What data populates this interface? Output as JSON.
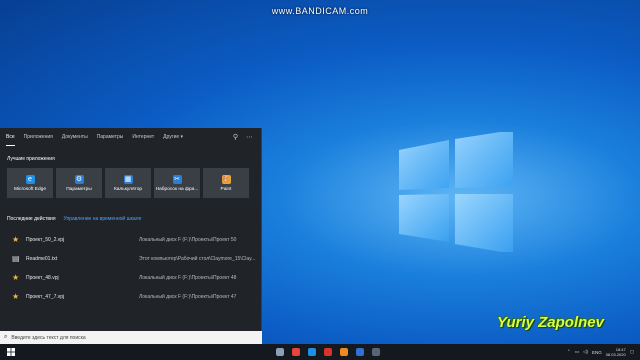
{
  "watermark": "www.BANDICAM.com",
  "signature": "Yuriy Zapolnev",
  "search_panel": {
    "tabs": [
      {
        "label": "Все",
        "active": true
      },
      {
        "label": "Приложения"
      },
      {
        "label": "Документы"
      },
      {
        "label": "Параметры"
      },
      {
        "label": "Интернет"
      },
      {
        "label": "Другие ▾"
      }
    ],
    "tab_icons": [
      "feedback-icon",
      "more-icon"
    ],
    "best_apps_title": "Лучшие приложения",
    "apps": [
      {
        "label": "Microsoft Edge",
        "icon": "edge-icon",
        "color": "#1e90e8",
        "glyph": "e"
      },
      {
        "label": "Параметры",
        "icon": "gear-icon",
        "color": "#2a7fd4",
        "glyph": "⚙"
      },
      {
        "label": "Калькулятор",
        "icon": "calculator-icon",
        "color": "#2a7fd4",
        "glyph": "▦"
      },
      {
        "label": "Набросок на фра...",
        "icon": "snip-sketch-icon",
        "color": "#2a7fd4",
        "glyph": "✂"
      },
      {
        "label": "Paint",
        "icon": "paint-icon",
        "color": "#e8a33a",
        "glyph": "🎨"
      }
    ],
    "recent_title": "Последние действия",
    "recent_link": "Управление на временной шкале",
    "recent": [
      {
        "name": "Проект_50_2.vpj",
        "path": "Локальный диск F (F:)\\Проекты\\Проект 50"
      },
      {
        "name": "Readme01.txt",
        "path": "Этот компьютер\\Рабочий стол\\Claymore_15\\Clay..."
      },
      {
        "name": "Проект_48.vpj",
        "path": "Локальный диск F (F:)\\Проекты\\Проект 48"
      },
      {
        "name": "Проект_47_7.vpj",
        "path": "Локальный диск F (F:)\\Проекты\\Проект 47"
      }
    ]
  },
  "search_box": {
    "placeholder": "Введите здесь текст для поиска"
  },
  "taskbar": {
    "apps": [
      {
        "name": "task-view-icon",
        "color": "#8aa0b8"
      },
      {
        "name": "browser-icon",
        "color": "#e8443a"
      },
      {
        "name": "edge-icon",
        "color": "#1e90e8"
      },
      {
        "name": "app-icon-red",
        "color": "#d9352b"
      },
      {
        "name": "app-icon-orange",
        "color": "#f08a24"
      },
      {
        "name": "app-icon-blue",
        "color": "#2f72d1"
      },
      {
        "name": "app-icon-dark",
        "color": "#586575"
      }
    ],
    "language": "ENG",
    "time": "18:47",
    "date": "08.03.2020"
  }
}
